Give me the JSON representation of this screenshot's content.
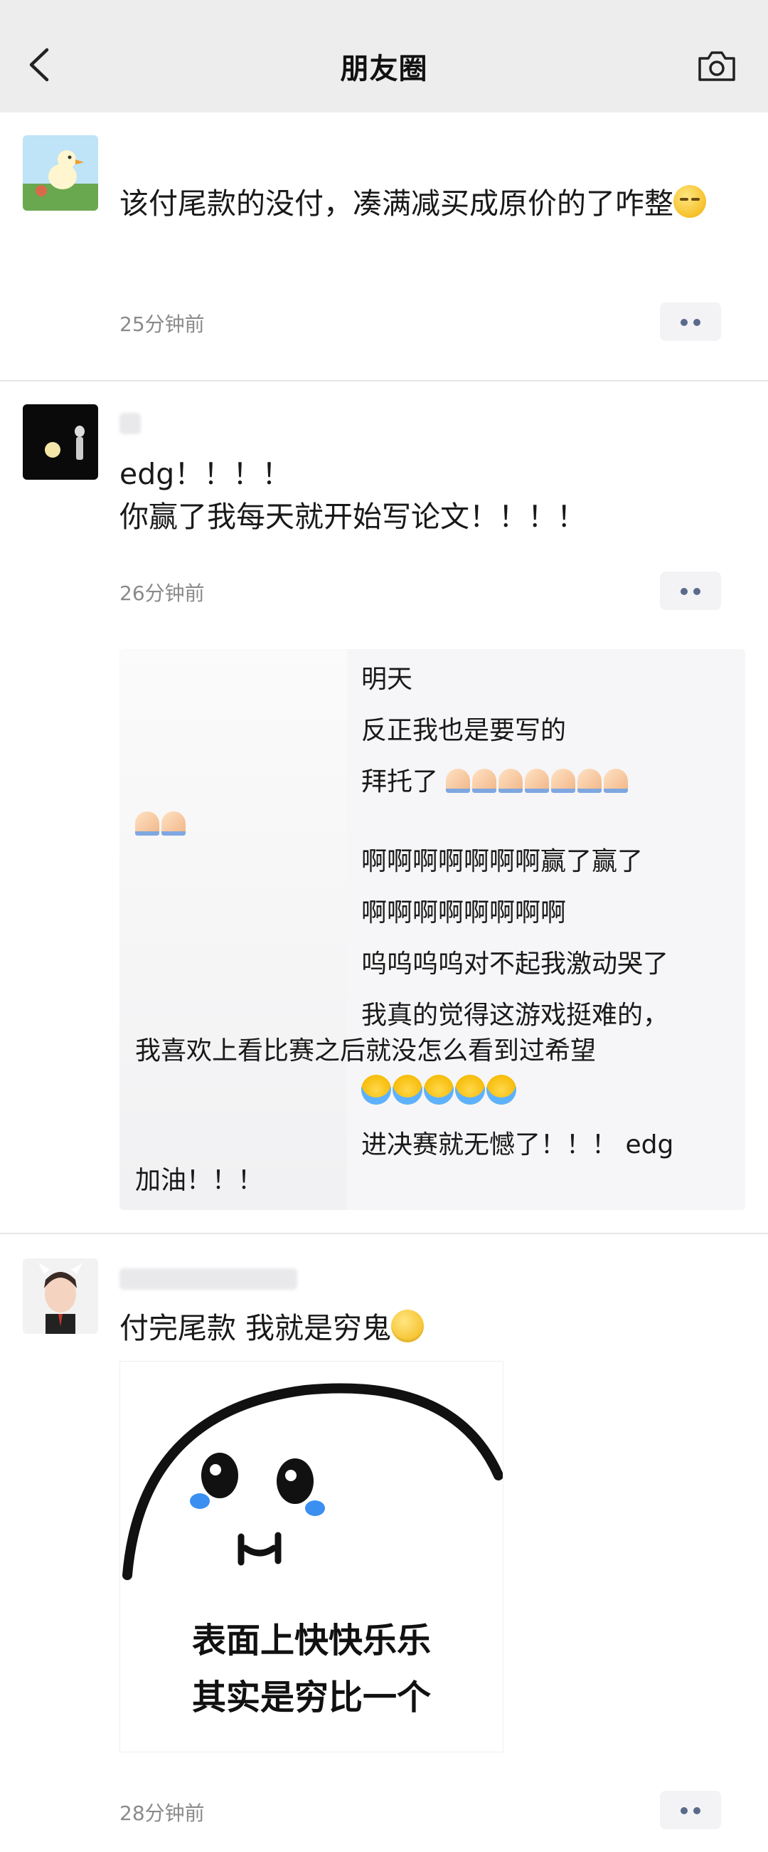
{
  "header": {
    "title": "朋友圈",
    "back_icon": "chevron-left-icon",
    "camera_icon": "camera-icon"
  },
  "posts": [
    {
      "text": "该付尾款的没付，凑满减买成原价的了咋整",
      "time": "25分钟前"
    },
    {
      "line1": "edg！！！！",
      "line2": "你赢了我每天就开始写论文！！！！",
      "time": "26分钟前",
      "comments": [
        "明天",
        "反正我也是要写的",
        "拜托了",
        "啊啊啊啊啊啊啊赢了赢了",
        "啊啊啊啊啊啊啊啊",
        "呜呜呜呜对不起我激动哭了",
        "我真的觉得这游戏挺难的，",
        "我喜欢上看比赛之后就没怎么看到过希望",
        "进决赛就无憾了！！！ edg",
        "加油！！！"
      ]
    },
    {
      "text": "付完尾款 我就是穷鬼",
      "time": "28分钟前",
      "meme_line1": "表面上快快乐乐",
      "meme_line2": "其实是穷比一个"
    }
  ]
}
